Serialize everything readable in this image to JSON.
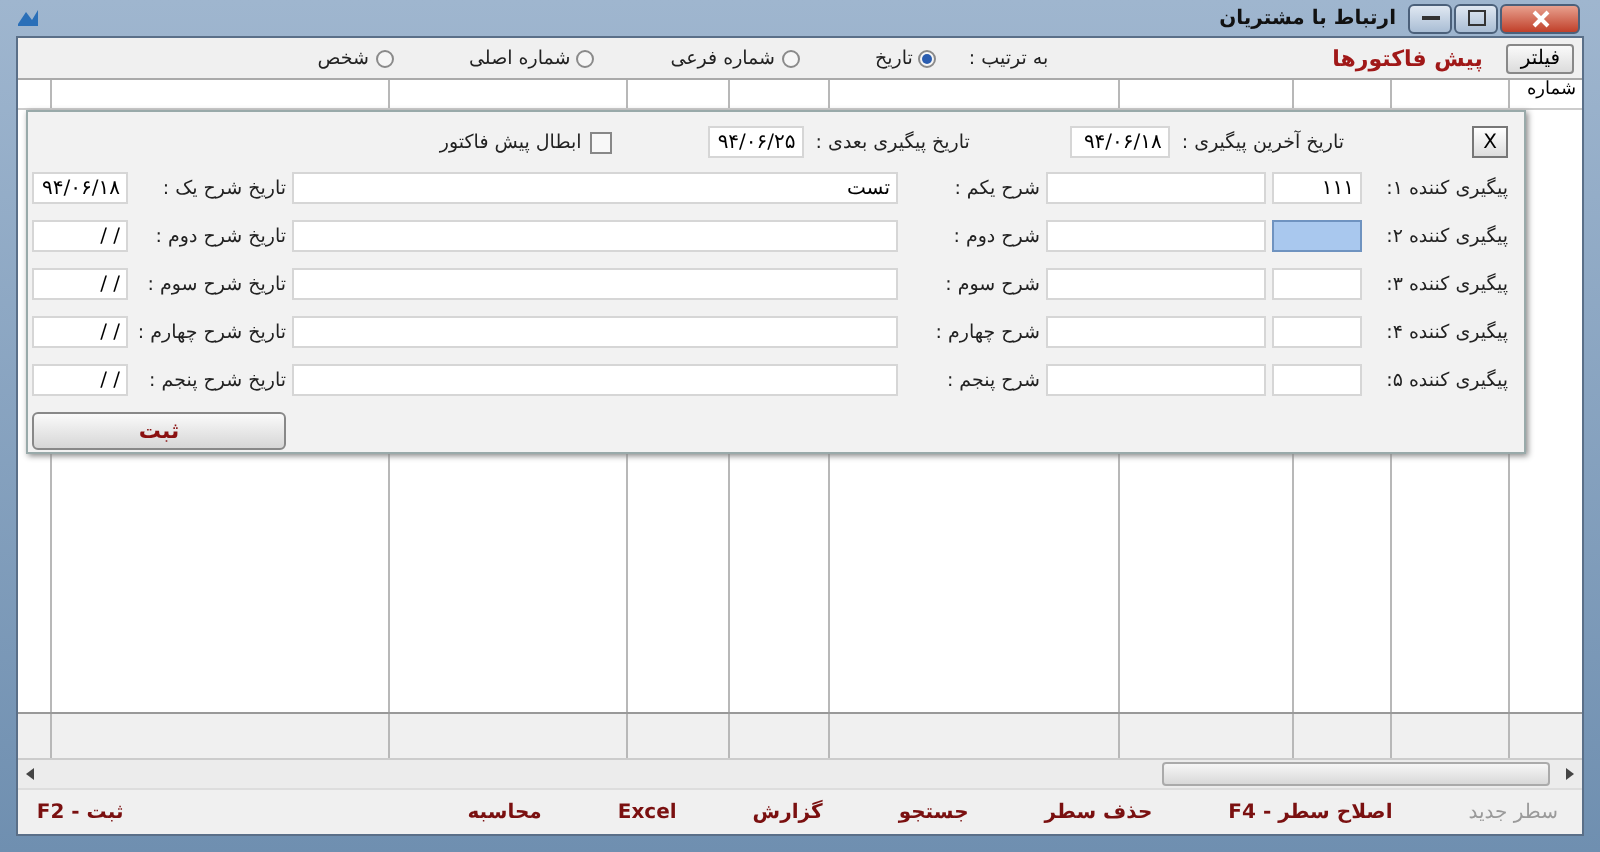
{
  "window": {
    "title": "ارتباط با مشتریان"
  },
  "toolbar": {
    "filter_button": "فیلتر",
    "section_title": "پیش فاکتورها",
    "sort_label": "به ترتیب :",
    "sort_options": [
      {
        "label": "تاریخ",
        "selected": true
      },
      {
        "label": "شماره فرعی",
        "selected": false
      },
      {
        "label": "شماره اصلی",
        "selected": false
      },
      {
        "label": "شخص",
        "selected": false
      }
    ]
  },
  "grid": {
    "first_column_header": "شماره"
  },
  "dialog": {
    "close_button": "X",
    "last_followup_label": "تاریخ آخرین پیگیری :",
    "last_followup_date": "۹۴/۰۶/۱۸",
    "next_followup_label": "تاریخ پیگیری بعدی :",
    "next_followup_date": "۹۴/۰۶/۲۵",
    "cancel_checkbox": {
      "label": "ابطال پیش فاکتور",
      "checked": false
    },
    "rows": [
      {
        "followup_label": "پیگیری کننده ۱:",
        "followup_code": "۱۱۱",
        "focused": false,
        "desc_label": "شرح یکم :",
        "desc": "تست",
        "date_label": "تاریخ شرح یک :",
        "date": "۹۴/۰۶/۱۸"
      },
      {
        "followup_label": "پیگیری کننده ۲:",
        "focused": true,
        "desc_label": "شرح دوم :",
        "date_label": "تاریخ شرح دوم :",
        "date": "/ /"
      },
      {
        "followup_label": "پیگیری کننده ۳:",
        "focused": false,
        "desc_label": "شرح سوم :",
        "date_label": "تاریخ شرح سوم :",
        "date": "/ /"
      },
      {
        "followup_label": "پیگیری کننده ۴:",
        "focused": false,
        "desc_label": "شرح چهارم :",
        "date_label": "تاریخ شرح چهارم :",
        "date": "/ /"
      },
      {
        "followup_label": "پیگیری کننده ۵:",
        "focused": false,
        "desc_label": "شرح پنجم :",
        "date_label": "تاریخ شرح پنجم :",
        "date": "/ /"
      }
    ],
    "submit_button": "ثبت"
  },
  "footer_buttons": [
    {
      "label": "سطر جدید",
      "disabled": true
    },
    {
      "label": "اصلاح سطر - F4",
      "disabled": false
    },
    {
      "label": "حذف سطر",
      "disabled": false
    },
    {
      "label": "جستجو",
      "disabled": false
    },
    {
      "label": "گزارش",
      "disabled": false
    },
    {
      "label": "Excel",
      "disabled": false
    },
    {
      "label": "محاسبه",
      "disabled": false
    },
    {
      "label": "ثبت - F2",
      "disabled": false
    }
  ]
}
